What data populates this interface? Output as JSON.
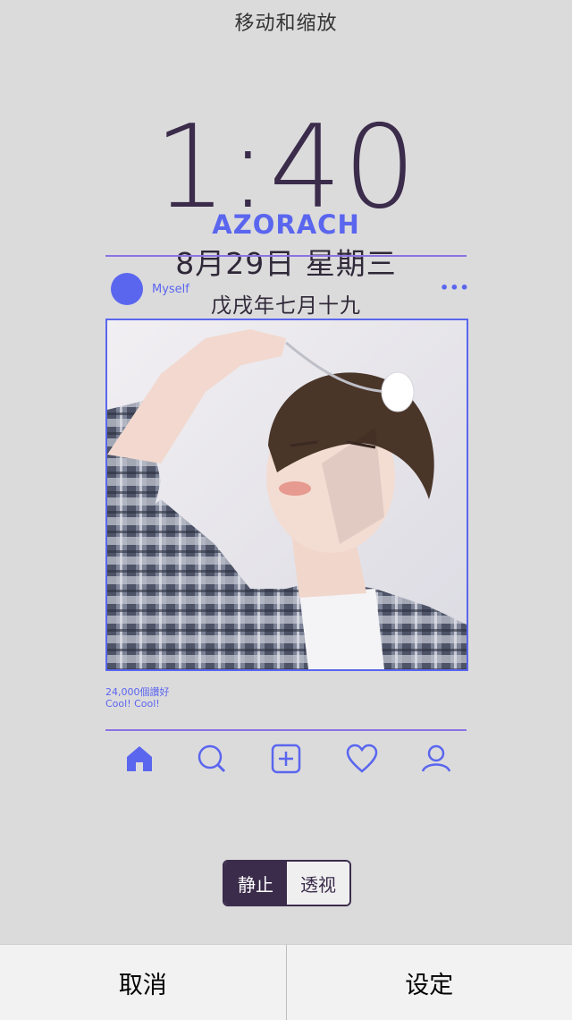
{
  "header": {
    "title": "移动和缩放"
  },
  "lockscreen": {
    "time": "1:40",
    "brand": "AZORACH",
    "date": "8月29日 星期三",
    "lunar_date": "戊戌年七月十九"
  },
  "post": {
    "username": "Myself",
    "more_icon": "ellipsis-icon",
    "likes": "24,000個讚好",
    "caption": "Cool! Cool!"
  },
  "bottom_nav": [
    {
      "icon": "home-icon"
    },
    {
      "icon": "search-icon"
    },
    {
      "icon": "add-icon"
    },
    {
      "icon": "heart-icon"
    },
    {
      "icon": "profile-icon"
    }
  ],
  "perspective_toggle": {
    "options": [
      "静止",
      "透视"
    ],
    "selected": "静止"
  },
  "footer": {
    "cancel": "取消",
    "set": "设定"
  },
  "colors": {
    "accent": "#5a66ee",
    "line": "#8a73e2",
    "dark": "#3b2c4b",
    "background": "#dcdbdc"
  }
}
